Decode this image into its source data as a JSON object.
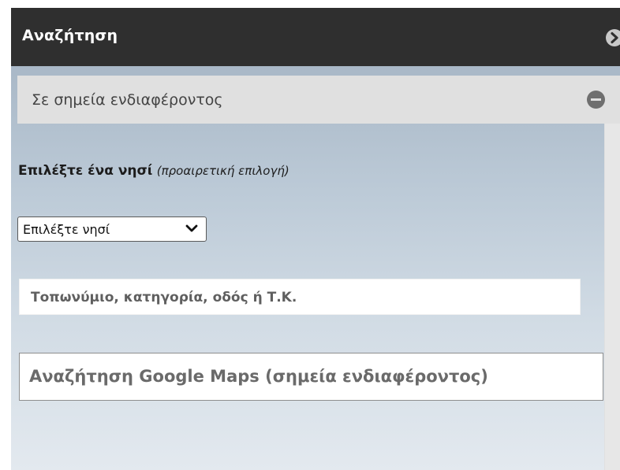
{
  "header": {
    "title": "Αναζήτηση",
    "arrow_icon": "chevron-right-circle-icon"
  },
  "section": {
    "title": "Σε σημεία ενδιαφέροντος",
    "collapse_icon": "minus-circle-icon"
  },
  "island": {
    "label_bold": "Επιλέξτε ένα νησί",
    "label_note": "(προαιρετική επιλογή)",
    "select_value": "Επιλέξτε νησί",
    "select_icon": "chevron-down-icon"
  },
  "search": {
    "place_placeholder": "Τοπωνύμιο, κατηγορία, οδός ή Τ.Κ.",
    "google_placeholder": "Αναζήτηση Google Maps (σημεία ενδιαφέροντος)"
  },
  "colors": {
    "header_bg": "#2f2f2f",
    "section_bg": "#e0e0e0",
    "panel_top": "#a9b8c7",
    "panel_bottom": "#e3e9ef"
  }
}
